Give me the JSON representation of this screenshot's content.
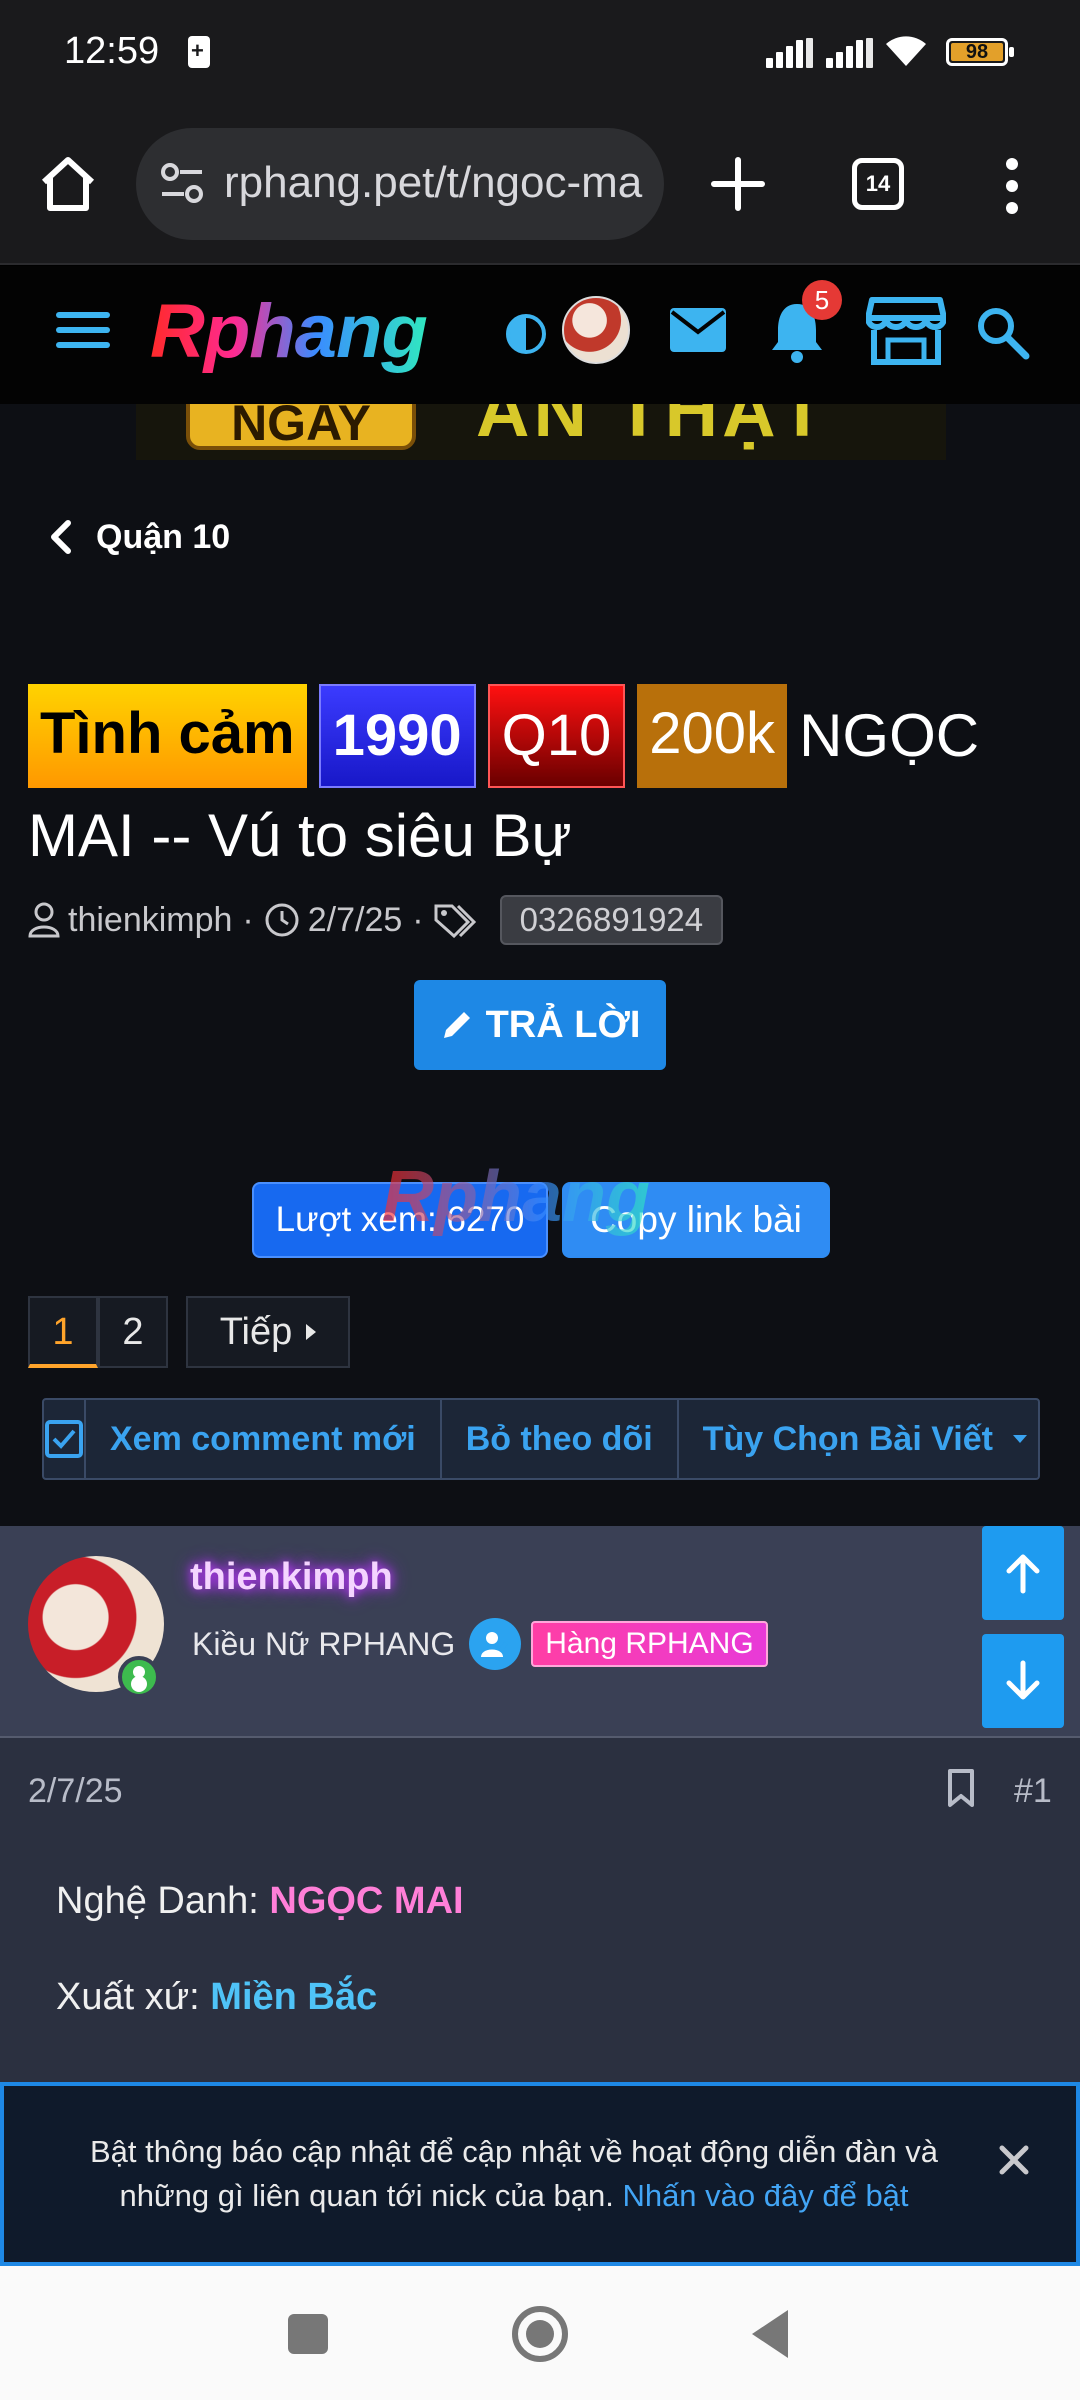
{
  "status_bar": {
    "time": "12:59",
    "battery": "98"
  },
  "browser": {
    "url": "rphang.pet/t/ngoc-mai",
    "tab_count": "14"
  },
  "site_header": {
    "logo_text": "Rphang",
    "notification_count": "5"
  },
  "banner": {
    "left_text": "NGAY",
    "right_text": "AN THẬT"
  },
  "breadcrumb": {
    "label": "Quận 10"
  },
  "thread": {
    "tags": [
      "Tình cảm",
      "1990",
      "Q10",
      "200k"
    ],
    "title_text": "NGỌC MAI -- Vú to siêu Bự",
    "author": "thienkimph",
    "date": "2/7/25",
    "phone_tag": "0326891924",
    "reply_label": "TRẢ LỜI",
    "views_label": "Lượt xem: 6270",
    "copy_label": "Copy link bài",
    "watermark": "Rphang"
  },
  "pagination": {
    "pages": [
      "1",
      "2"
    ],
    "next_label": "Tiếp"
  },
  "actions": {
    "new_comments": "Xem comment mới",
    "unfollow": "Bỏ theo dõi",
    "options": "Tùy Chọn Bài Viết"
  },
  "post": {
    "username": "thienkimph",
    "rank": "Kiều Nữ RPHANG",
    "badge": "Hàng RPHANG",
    "date": "2/7/25",
    "number": "#1",
    "line1_label": "Nghệ Danh:",
    "line1_value": "NGỌC MAI",
    "line2_label": "Xuất xứ:",
    "line2_value": "Miền Bắc"
  },
  "notification": {
    "text": "Bật thông báo cập nhật để cập nhật về hoạt động diễn đàn và những gì liên quan tới nick của bạn.",
    "link": "Nhấn vào đây để bật"
  },
  "colors": {
    "accent": "#1e88e5",
    "link": "#3aa3f0",
    "tag_yellow": "#ffd300",
    "tag_blue": "#2a2aff",
    "tag_red": "#d00000",
    "tag_orange": "#b8700b"
  }
}
